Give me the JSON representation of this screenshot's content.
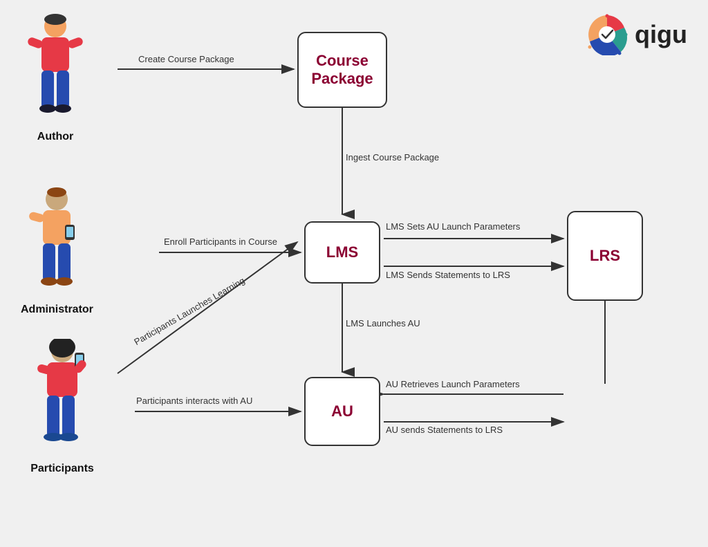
{
  "logo": {
    "text": "qigu"
  },
  "boxes": {
    "course_package": {
      "label": "Course\nPackage"
    },
    "lms": {
      "label": "LMS"
    },
    "lrs": {
      "label": "LRS"
    },
    "au": {
      "label": "AU"
    }
  },
  "persons": {
    "author": {
      "label": "Author"
    },
    "administrator": {
      "label": "Administrator"
    },
    "participants": {
      "label": "Participants"
    }
  },
  "arrow_labels": {
    "create_course_package": "Create Course Package",
    "ingest_course_package": "Ingest Course Package",
    "enroll_participants": "Enroll Participants in Course",
    "lms_sets_au_launch": "LMS Sets AU Launch Parameters",
    "lms_sends_statements": "LMS Sends Statements to LRS",
    "lms_launches_au": "LMS Launches AU",
    "participants_launches": "Participants Launches Learning",
    "participants_interacts": "Participants interacts with AU",
    "au_retrieves": "AU Retrieves Launch Parameters",
    "au_sends": "AU sends Statements to LRS"
  }
}
